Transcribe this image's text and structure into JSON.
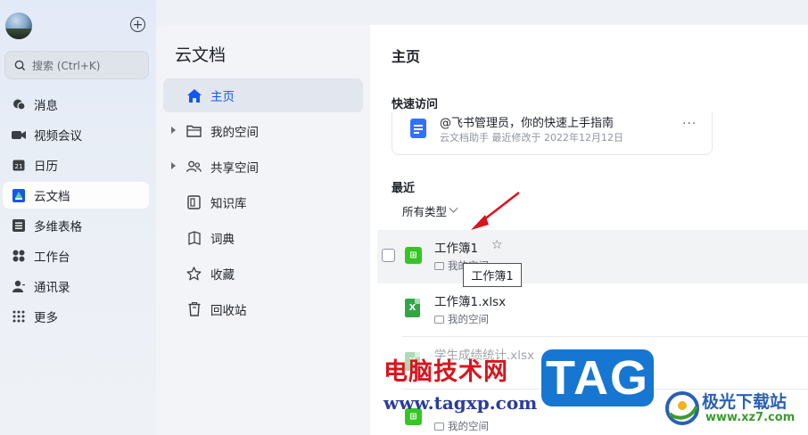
{
  "nav": {
    "search_placeholder": "搜索 (Ctrl+K)",
    "items": [
      {
        "label": "消息",
        "icon": "chat-bubble-icon"
      },
      {
        "label": "视频会议",
        "icon": "video-camera-icon"
      },
      {
        "label": "日历",
        "icon": "calendar-icon"
      },
      {
        "label": "云文档",
        "icon": "cloud-docs-icon",
        "active": true
      },
      {
        "label": "多维表格",
        "icon": "base-table-icon"
      },
      {
        "label": "工作台",
        "icon": "workplace-grid-icon"
      },
      {
        "label": "通讯录",
        "icon": "contacts-icon"
      },
      {
        "label": "更多",
        "icon": "more-dots-icon"
      }
    ]
  },
  "doc_sidebar": {
    "title": "云文档",
    "items": [
      {
        "label": "主页",
        "icon": "home-icon",
        "active": true
      },
      {
        "label": "我的空间",
        "icon": "folder-icon"
      },
      {
        "label": "共享空间",
        "icon": "shared-users-icon"
      },
      {
        "label": "知识库",
        "icon": "wiki-book-icon"
      },
      {
        "label": "词典",
        "icon": "dictionary-icon"
      },
      {
        "label": "收藏",
        "icon": "star-icon"
      },
      {
        "label": "回收站",
        "icon": "trash-icon"
      }
    ]
  },
  "main": {
    "title": "主页",
    "quick_access_title": "快速访问",
    "quick_card": {
      "title": "@飞书管理员，你的快速上手指南",
      "subtitle": "云文档助手  最近修改于 2022年12月12日",
      "more": "···"
    },
    "recent_title": "最近",
    "type_filter": "所有类型",
    "files": [
      {
        "name": "工作簿1",
        "location": "我的空间",
        "type": "sheet",
        "icon_glyph": "⊞"
      },
      {
        "name": "工作簿1.xlsx",
        "location": "我的空间",
        "type": "xlsx",
        "icon_glyph": "X"
      },
      {
        "name": "学生成绩统计.xlsx",
        "location": "我的空间",
        "type": "xlsx",
        "icon_glyph": "X"
      },
      {
        "name": "",
        "location": "我的空间",
        "type": "sheet",
        "icon_glyph": "⊞"
      }
    ],
    "tooltip": "工作簿1"
  },
  "watermarks": {
    "site_cn": "电脑技术网",
    "site_url": "www.tagxp.com",
    "tag": "TAG",
    "jg_name": "极光下载站",
    "jg_url": "www.xz7.com"
  },
  "colors": {
    "accent": "#1456f0",
    "sheet_green": "#34c724",
    "doc_blue": "#3370ff",
    "arrow_red": "#d8141c"
  }
}
